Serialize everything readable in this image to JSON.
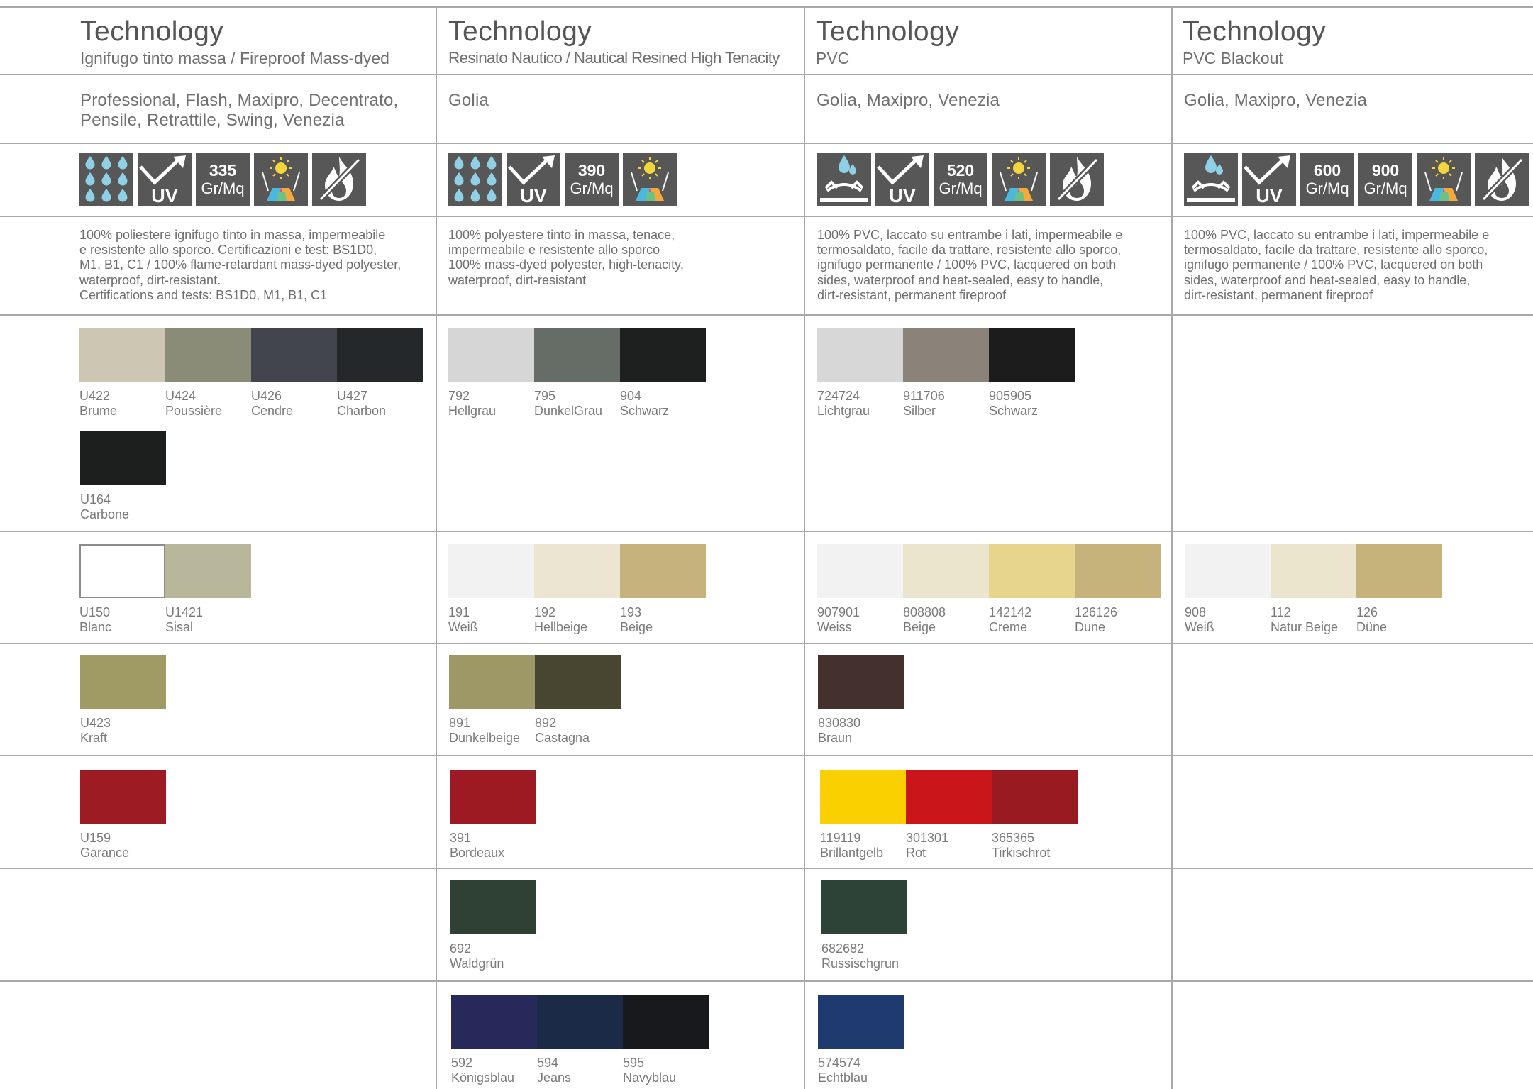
{
  "columns": [
    {
      "title": "Technology",
      "subtitle": "Ignifugo tinto massa / Fireproof Mass-dyed",
      "models_line1": "Professional, Flash, Maxipro, Decentrato,",
      "models_line2": "Pensile, Retrattile, Swing, Venezia",
      "weights": [
        "335"
      ],
      "weight_unit": "Gr/Mq",
      "description": [
        "100% poliestere ignifugo tinto in massa, impermeabile",
        "e resistente allo sporco. Certificazioni e test: BS1D0,",
        "M1, B1, C1 / 100% flame-retardant mass-dyed polyester,",
        "waterproof, dirt-resistant.",
        "Certifications and tests: BS1D0, M1, B1, C1"
      ]
    },
    {
      "title": "Technology",
      "subtitle": "Resinato Nautico / Nautical Resined High Tenacity",
      "models_line1": "Golia",
      "weights": [
        "390"
      ],
      "weight_unit": "Gr/Mq",
      "description": [
        "100% polyestere tinto in massa,  tenace,",
        "impermeabile e resistente allo sporco",
        "100% mass-dyed polyester, high-tenacity,",
        "waterproof, dirt-resistant"
      ]
    },
    {
      "title": "Technology",
      "subtitle": "PVC",
      "models_line1": "Golia, Maxipro, Venezia",
      "weights": [
        "520"
      ],
      "weight_unit": "Gr/Mq",
      "description": [
        "100% PVC, laccato su entrambe i lati, impermeabile e",
        "termosaldato, facile da trattare, resistente allo sporco,",
        "ignifugo permanente / 100% PVC, lacquered on both",
        "sides, waterproof and heat-sealed, easy to handle,",
        "dirt-resistant, permanent fireproof"
      ]
    },
    {
      "title": "Technology",
      "subtitle": "PVC Blackout",
      "models_line1": "Golia, Maxipro, Venezia",
      "weights": [
        "600",
        "900"
      ],
      "weight_unit": "Gr/Mq",
      "description": [
        "100% PVC, laccato su entrambe i lati, impermeabile e",
        "termosaldato, facile da trattare, resistente allo sporco,",
        "ignifugo permanente / 100% PVC, lacquered on both",
        "sides, waterproof and heat-sealed, easy to handle,",
        "dirt-resistant, permanent fireproof"
      ]
    }
  ],
  "icon_set": {
    "col1": [
      "water-repellent-icon",
      "uv-resistant-icon",
      "weight-icon",
      "colorfast-icon",
      "fireproof-icon"
    ],
    "col2": [
      "water-repellent-icon",
      "uv-resistant-icon",
      "weight-icon",
      "colorfast-icon"
    ],
    "col3": [
      "waterproof-icon",
      "uv-resistant-icon",
      "weight-icon",
      "colorfast-icon",
      "fireproof-icon"
    ],
    "col4": [
      "waterproof-icon",
      "uv-resistant-icon",
      "weight-icon",
      "weight-icon",
      "colorfast-icon",
      "fireproof-icon"
    ],
    "uv_label": "UV"
  },
  "swatches": {
    "c1_r1a": [
      {
        "code": "U422",
        "name": "Brume",
        "color": "#cdc6b2"
      },
      {
        "code": "U424",
        "name": "Poussière",
        "color": "#8a8c78"
      },
      {
        "code": "U426",
        "name": "Cendre",
        "color": "#42454d"
      },
      {
        "code": "U427",
        "name": "Charbon",
        "color": "#24282b"
      }
    ],
    "c1_r1b": [
      {
        "code": "U164",
        "name": "Carbone",
        "color": "#1d1f1e"
      }
    ],
    "c1_r2": [
      {
        "code": "U150",
        "name": "Blanc",
        "color": "#ffffff"
      },
      {
        "code": "U1421",
        "name": "Sisal",
        "color": "#b8b79c"
      }
    ],
    "c1_r3": [
      {
        "code": "U423",
        "name": "Kraft",
        "color": "#a09a65"
      }
    ],
    "c1_r4": [
      {
        "code": "U159",
        "name": "Garance",
        "color": "#9d1b22"
      }
    ],
    "c2_r1": [
      {
        "code": "792",
        "name": "Hellgrau",
        "color": "#d6d6d6"
      },
      {
        "code": "795",
        "name": "DunkelGrau",
        "color": "#666d66"
      },
      {
        "code": "904",
        "name": "Schwarz",
        "color": "#1e1f1f"
      }
    ],
    "c2_r2": [
      {
        "code": "191",
        "name": "Weiß",
        "color": "#f2f2f2"
      },
      {
        "code": "192",
        "name": "Hellbeige",
        "color": "#ebe5d1"
      },
      {
        "code": "193",
        "name": "Beige",
        "color": "#c5b27c"
      }
    ],
    "c2_r3": [
      {
        "code": "891",
        "name": "Dunkelbeige",
        "color": "#9d9866"
      },
      {
        "code": "892",
        "name": "Castagna",
        "color": "#484531"
      }
    ],
    "c2_r4": [
      {
        "code": "391",
        "name": "Bordeaux",
        "color": "#9e1a22"
      }
    ],
    "c2_r5": [
      {
        "code": "692",
        "name": "Waldgrün",
        "color": "#2f4135"
      }
    ],
    "c2_r6": [
      {
        "code": "592",
        "name": "Königsblau",
        "color": "#262959"
      },
      {
        "code": "594",
        "name": "Jeans",
        "color": "#1b2a46"
      },
      {
        "code": "595",
        "name": "Navyblau",
        "color": "#18191c"
      }
    ],
    "c3_r1": [
      {
        "code": "724724",
        "name": "Lichtgrau",
        "color": "#d7d7d7"
      },
      {
        "code": "911706",
        "name": "Silber",
        "color": "#8b8379"
      },
      {
        "code": "905905",
        "name": "Schwarz",
        "color": "#1c1c1c"
      }
    ],
    "c3_r2": [
      {
        "code": "907901",
        "name": "Weiss",
        "color": "#f2f2f2"
      },
      {
        "code": "808808",
        "name": "Beige",
        "color": "#ebe5ce"
      },
      {
        "code": "142142",
        "name": "Creme",
        "color": "#e7d58d"
      },
      {
        "code": "126126",
        "name": "Dune",
        "color": "#c6b27b"
      }
    ],
    "c3_r3": [
      {
        "code": "830830",
        "name": "Braun",
        "color": "#44302d"
      }
    ],
    "c3_r4": [
      {
        "code": "119119",
        "name": "Brillantgelb",
        "color": "#fbd000"
      },
      {
        "code": "301301",
        "name": "Rot",
        "color": "#ca161a"
      },
      {
        "code": "365365",
        "name": "Tirkischrot",
        "color": "#9a1a21"
      }
    ],
    "c3_r5": [
      {
        "code": "682682",
        "name": "Russischgrun",
        "color": "#2d4337"
      }
    ],
    "c3_r6": [
      {
        "code": "574574",
        "name": "Echtblau",
        "color": "#1e3a6e"
      }
    ],
    "c4_r2": [
      {
        "code": "908",
        "name": "Weiß",
        "color": "#f2f2f2"
      },
      {
        "code": "112",
        "name": "Natur Beige",
        "color": "#ebe5ce"
      },
      {
        "code": "126",
        "name": "Düne",
        "color": "#c6b27b"
      }
    ]
  }
}
